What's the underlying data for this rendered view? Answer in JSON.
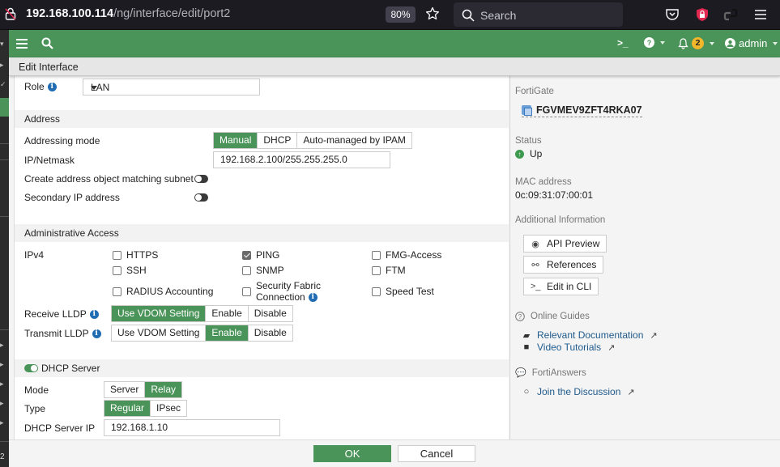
{
  "browser": {
    "url_host": "192.168.100.114",
    "url_path": "/ng/interface/edit/port2",
    "zoom": "80%",
    "search_placeholder": "Search"
  },
  "left_strip": {
    "bottom_number": "2"
  },
  "topbar": {
    "notification_count": "2",
    "user_label": "admin"
  },
  "title": "Edit Interface",
  "form": {
    "role": {
      "label": "Role",
      "value": "LAN"
    },
    "address": {
      "section_title": "Address",
      "addressing_mode": {
        "label": "Addressing mode",
        "options": [
          "Manual",
          "DHCP",
          "Auto-managed by IPAM"
        ],
        "selected": "Manual"
      },
      "ip_netmask": {
        "label": "IP/Netmask",
        "value": "192.168.2.100/255.255.255.0"
      },
      "create_object": {
        "label": "Create address object matching subnet",
        "enabled": false
      },
      "secondary_ip": {
        "label": "Secondary IP address",
        "enabled": false
      }
    },
    "admin_access": {
      "section_title": "Administrative Access",
      "ipv4_label": "IPv4",
      "options": [
        {
          "label": "HTTPS",
          "checked": false
        },
        {
          "label": "PING",
          "checked": true
        },
        {
          "label": "FMG-Access",
          "checked": false
        },
        {
          "label": "SSH",
          "checked": false
        },
        {
          "label": "SNMP",
          "checked": false
        },
        {
          "label": "FTM",
          "checked": false
        },
        {
          "label": "RADIUS Accounting",
          "checked": false
        },
        {
          "label": "Security Fabric",
          "label2": "Connection",
          "checked": false
        },
        {
          "label": "Speed Test",
          "checked": false
        }
      ],
      "receive_lldp": {
        "label": "Receive LLDP",
        "options": [
          "Use VDOM Setting",
          "Enable",
          "Disable"
        ],
        "selected": "Use VDOM Setting"
      },
      "transmit_lldp": {
        "label": "Transmit LLDP",
        "options": [
          "Use VDOM Setting",
          "Enable",
          "Disable"
        ],
        "selected": "Enable"
      }
    },
    "dhcp": {
      "section_title": "DHCP Server",
      "enabled": true,
      "mode": {
        "label": "Mode",
        "options": [
          "Server",
          "Relay"
        ],
        "selected": "Relay"
      },
      "type": {
        "label": "Type",
        "options": [
          "Regular",
          "IPsec"
        ],
        "selected": "Regular"
      },
      "server_ip": {
        "label": "DHCP Server IP",
        "value": "192.168.1.10"
      }
    }
  },
  "footer": {
    "ok_label": "OK",
    "cancel_label": "Cancel"
  },
  "side": {
    "fortigate_label": "FortiGate",
    "device_name": "FGVMEV9ZFT4RKA07",
    "status_label": "Status",
    "status_value": "Up",
    "mac_label": "MAC address",
    "mac_value": "0c:09:31:07:00:01",
    "additional_label": "Additional Information",
    "buttons": [
      "API Preview",
      "References",
      "Edit in CLI"
    ],
    "online_guides_label": "Online Guides",
    "guides": [
      "Relevant Documentation",
      "Video Tutorials"
    ],
    "fortianswers_label": "FortiAnswers",
    "discussion_label": "Join the Discussion"
  },
  "colors": {
    "brand_green": "#4a9359",
    "link_blue": "#1f5a8c",
    "badge_yellow": "#f2b72b"
  }
}
